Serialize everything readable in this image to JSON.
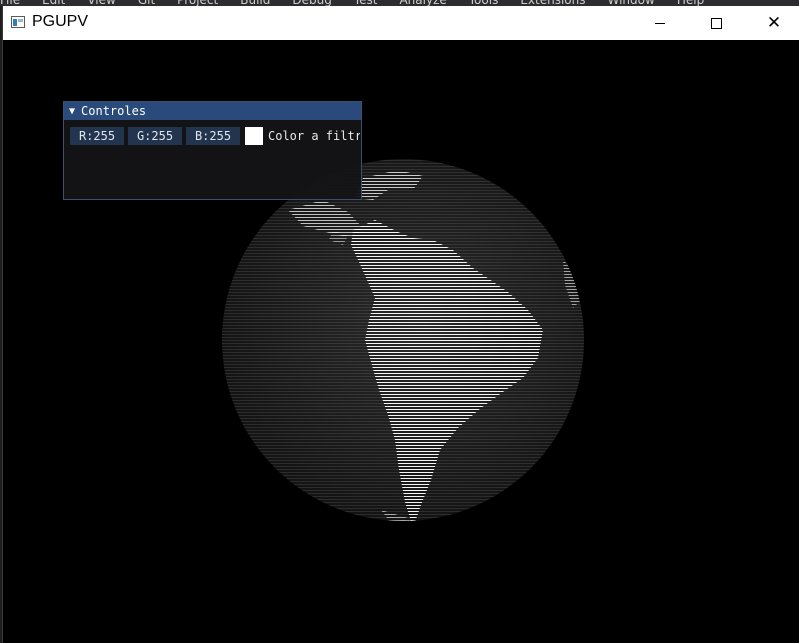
{
  "window": {
    "title": "PGUPV",
    "minimize_icon": "minimize-icon",
    "maximize_icon": "maximize-icon",
    "close_icon": "close-icon",
    "close_glyph": "✕"
  },
  "panel": {
    "title": "Controles",
    "collapse_glyph": "▼",
    "r_value": "R:255",
    "g_value": "G:255",
    "b_value": "B:255",
    "swatch_color": "#ffffff",
    "color_label": "Color a filtr"
  },
  "colors": {
    "title_bar": "#ffffff",
    "viewport": "#000000",
    "panel_header": "#294a7a",
    "drag_field": "#23344f"
  }
}
